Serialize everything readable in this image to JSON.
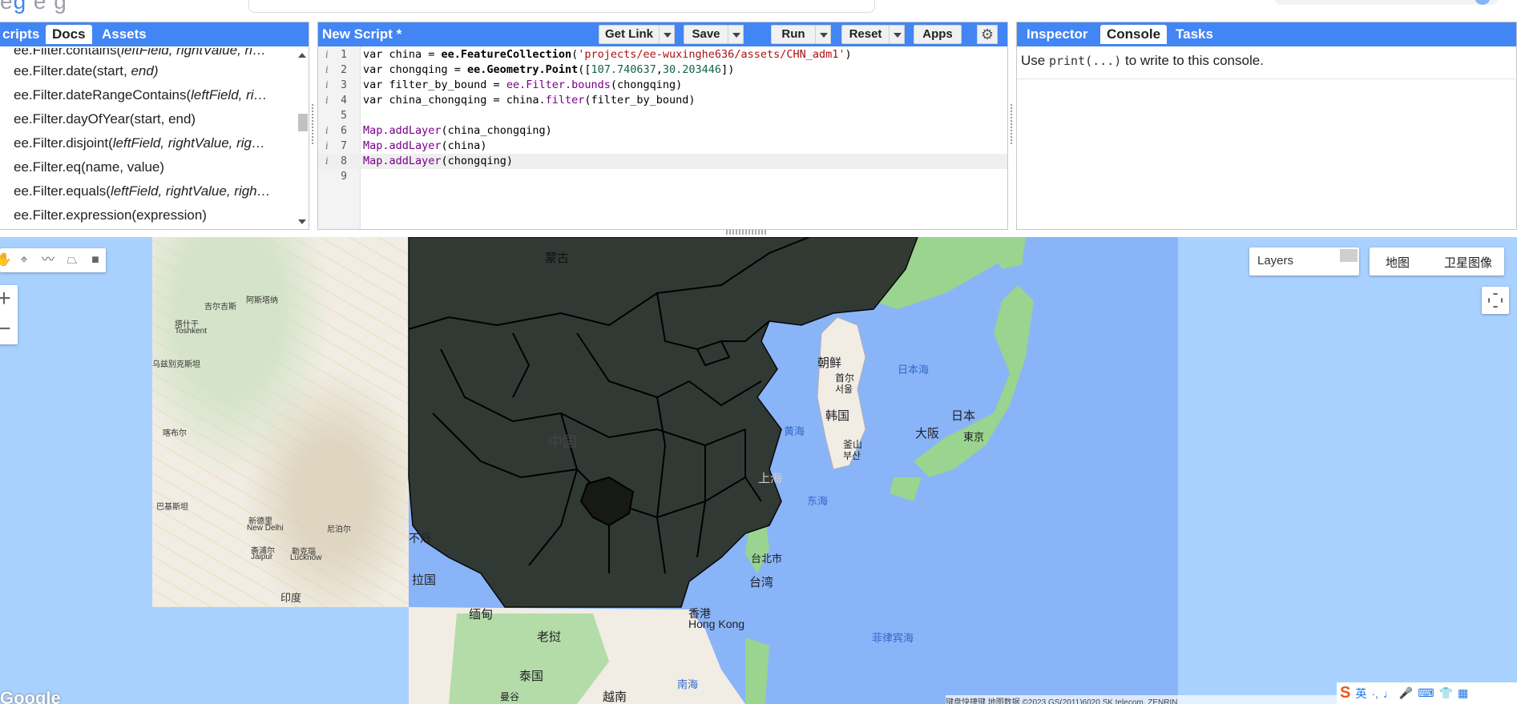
{
  "left_panel": {
    "tabs": [
      {
        "label": "cripts",
        "active": false
      },
      {
        "label": "Docs",
        "active": true
      },
      {
        "label": "Assets",
        "active": false
      }
    ],
    "docs": [
      {
        "name": "ee.Filter.contains(",
        "args": "leftField, rightValue, ri…"
      },
      {
        "name": "ee.Filter.date(start, ",
        "args": "end)"
      },
      {
        "name": "ee.Filter.dateRangeContains(",
        "args": "leftField, ri…"
      },
      {
        "name": "ee.Filter.dayOfYear(start, end)",
        "args": ""
      },
      {
        "name": "ee.Filter.disjoint(",
        "args": "leftField, rightValue, rig…"
      },
      {
        "name": "ee.Filter.eq(name, value)",
        "args": ""
      },
      {
        "name": "ee.Filter.equals(",
        "args": "leftField, rightValue, righ…"
      },
      {
        "name": "ee.Filter.expression(expression)",
        "args": ""
      }
    ]
  },
  "editor": {
    "title": "New Script *",
    "buttons": {
      "get_link": "Get Link",
      "save": "Save",
      "run": "Run",
      "reset": "Reset",
      "apps": "Apps"
    },
    "lines": [
      {
        "num": "1",
        "info": "i",
        "code": "var china = ee.FeatureCollection('projects/ee-wuxinghe636/assets/CHN_adm1')"
      },
      {
        "num": "2",
        "info": "i",
        "code": "var chongqing = ee.Geometry.Point([107.740637,30.203446])"
      },
      {
        "num": "3",
        "info": "i",
        "code": "var filter_by_bound = ee.Filter.bounds(chongqing)"
      },
      {
        "num": "4",
        "info": "i",
        "code": "var china_chongqing = china.filter(filter_by_bound)"
      },
      {
        "num": "5",
        "info": "",
        "code": ""
      },
      {
        "num": "6",
        "info": "i",
        "code": "Map.addLayer(china_chongqing)"
      },
      {
        "num": "7",
        "info": "i",
        "code": "Map.addLayer(china)"
      },
      {
        "num": "8",
        "info": "i",
        "code": "Map.addLayer(chongqing)"
      },
      {
        "num": "9",
        "info": "",
        "code": ""
      }
    ]
  },
  "right_panel": {
    "tabs": [
      {
        "label": "Inspector",
        "active": false
      },
      {
        "label": "Console",
        "active": true
      },
      {
        "label": "Tasks",
        "active": false
      }
    ],
    "console_prefix": "Use ",
    "console_code": "print(...)",
    "console_suffix": " to write to this console."
  },
  "map": {
    "layers_label": "Layers",
    "map_type_options": [
      "地图",
      "卫星图像"
    ],
    "selected_map_type": "地图",
    "labels": {
      "mongolia": "蒙古",
      "china": "中国",
      "korea_north": "朝鲜",
      "seoul_cn": "首尔",
      "seoul_kr": "서울",
      "korea_south": "韩国",
      "busan_cn": "釜山",
      "busan_kr": "부산",
      "japan": "日本",
      "sea_of_japan": "日本海",
      "osaka": "大阪",
      "tokyo": "東京",
      "yellow_sea": "黄海",
      "shanghai": "上海",
      "east_china_sea": "东海",
      "taipei": "台北市",
      "taiwan": "台湾",
      "hong_kong_cn": "香港",
      "hong_kong_en": "Hong Kong",
      "philippine_sea": "菲律宾海",
      "myanmar": "缅甸",
      "laos": "老挝",
      "thailand": "泰国",
      "vietnam": "越南",
      "south_china_sea": "南海",
      "bangladesh": "拉国",
      "bhutan_frag": "不丹",
      "manguse": "曼谷"
    },
    "terrain_labels": {
      "astana": "阿斯塔纳",
      "kyrgyz": "吉尔吉斯",
      "tashkent": "塔什干",
      "tashkent_en": "Toshkent",
      "kabul": "喀布尔",
      "pakistan": "巴基斯坦",
      "new_delhi": "新德里",
      "new_delhi_en": "New Delhi",
      "india": "印度",
      "nepal": "尼泊尔",
      "jaipur": "斋浦尔",
      "jaipur_en": "Jaipur",
      "lucknow": "勒克瑙",
      "lucknow_en": "Lucknow",
      "uzbek": "乌兹别克斯坦"
    },
    "google_logo": "Google",
    "attribution": "键盘快捷键   地图数据 ©2023 GS(2011)6020 SK telecom, ZENRIN",
    "ime": [
      "S",
      "英",
      "·,",
      "♩",
      "🎤",
      "⌨",
      "👕",
      "▦"
    ]
  },
  "colors": {
    "accent": "#4285f4",
    "ocean": "#a8d1ff",
    "china_fill": "#2e342e",
    "highlight": "#161916"
  }
}
